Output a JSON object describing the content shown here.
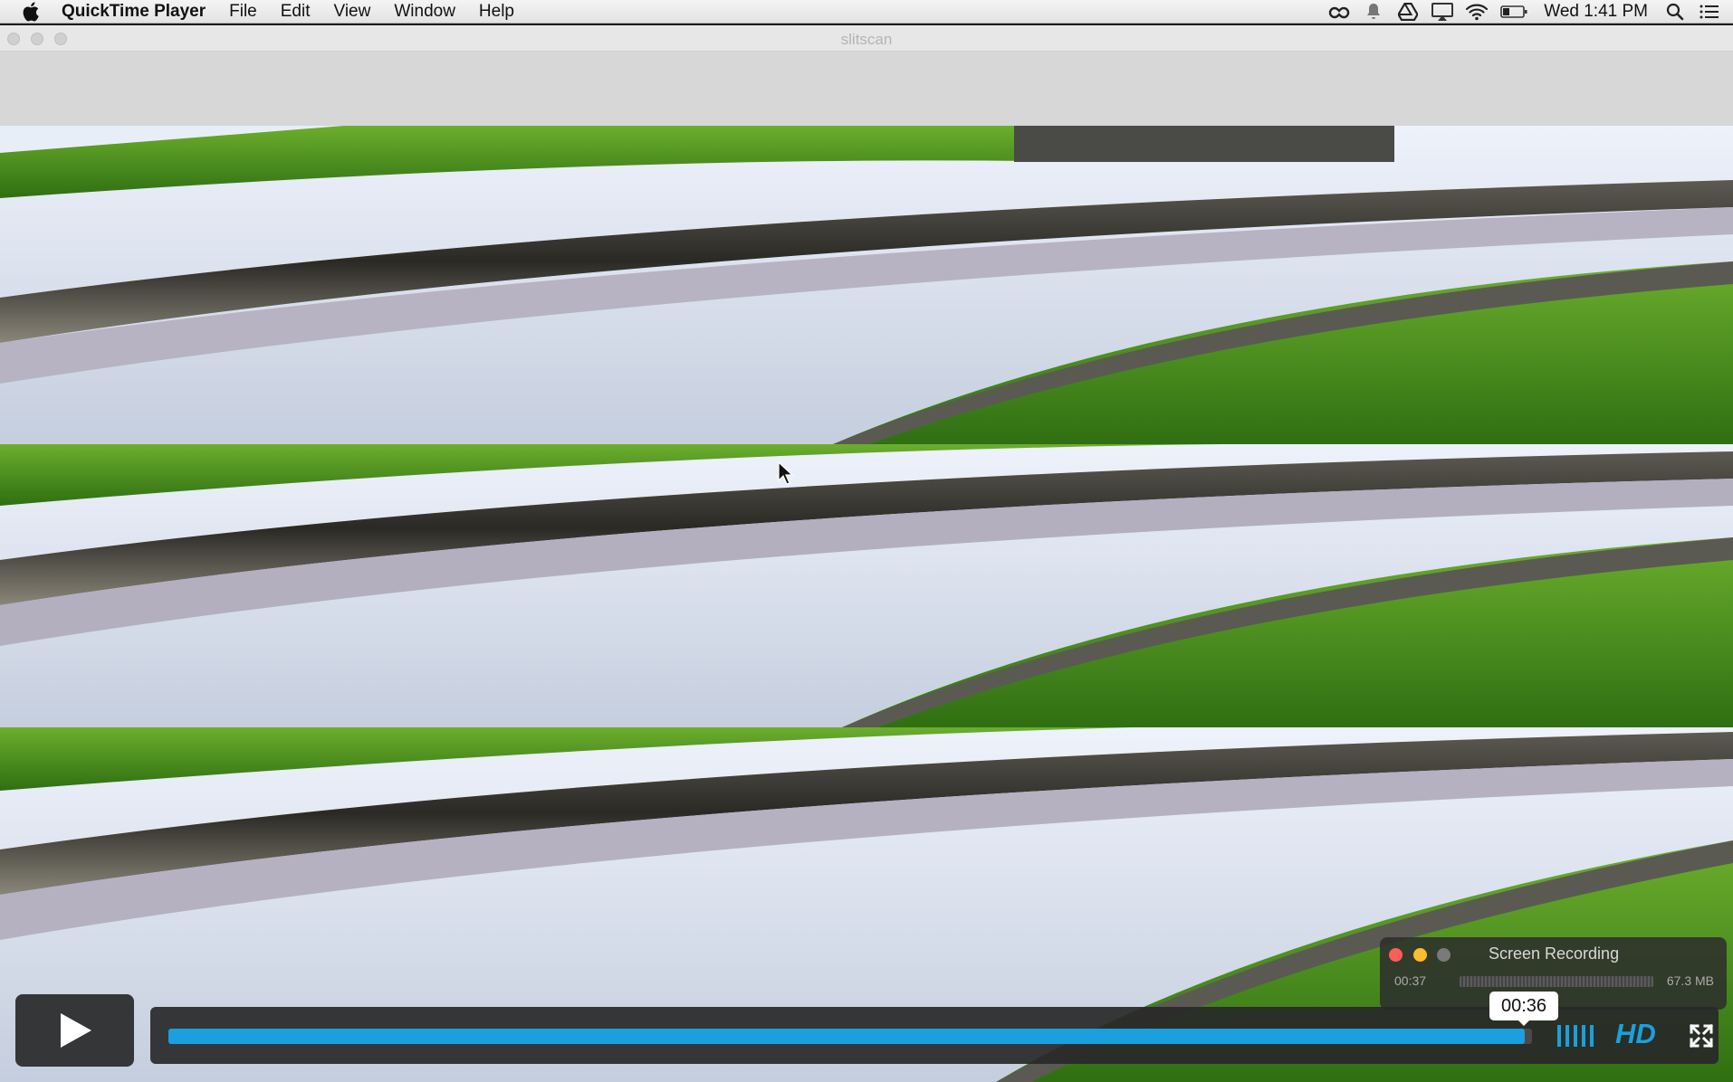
{
  "menubar": {
    "app_name": "QuickTime Player",
    "menus": [
      "File",
      "Edit",
      "View",
      "Window",
      "Help"
    ],
    "clock": "Wed 1:41 PM",
    "status_icons": [
      "creative-cloud-icon",
      "notification-bell-icon",
      "google-drive-icon",
      "airplay-icon",
      "wifi-icon",
      "battery-icon",
      "spotlight-search-icon",
      "notification-center-icon"
    ]
  },
  "window": {
    "title": "slitscan"
  },
  "recording_hud": {
    "title": "Screen Recording",
    "elapsed": "00:37",
    "file_size": "67.3 MB"
  },
  "player": {
    "playhead_time": "00:36",
    "progress": 0.995,
    "hd_label": "HD"
  },
  "colors": {
    "accent": "#1aa0de",
    "grass": "#4f9a1f",
    "sky": "#dfe6f4"
  }
}
